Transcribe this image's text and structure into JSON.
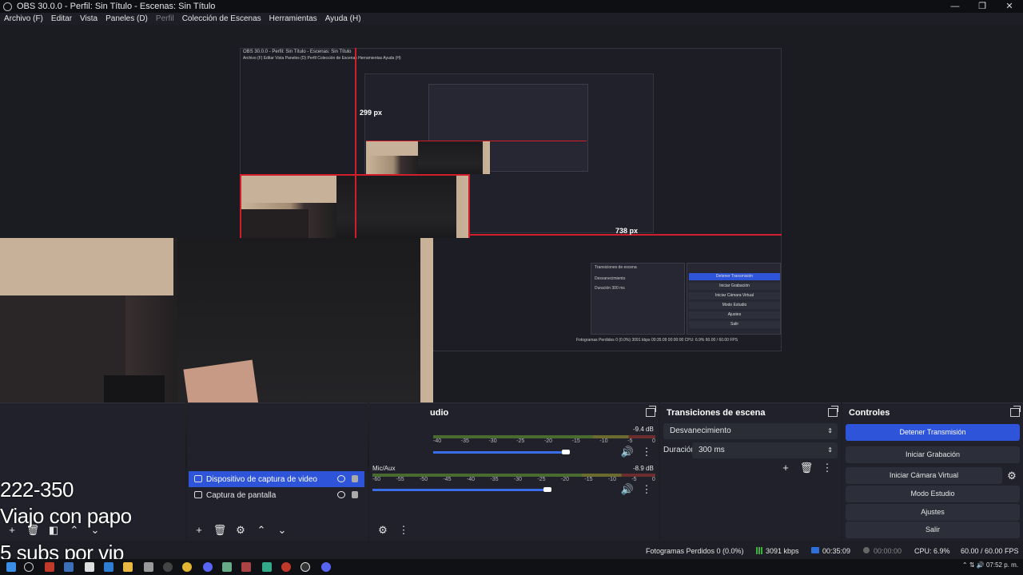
{
  "window": {
    "title": "OBS 30.0.0 - Perfil: Sin Título - Escenas: Sin Título",
    "controls": [
      "—",
      "❐",
      "✕"
    ]
  },
  "menu": [
    "Archivo (F)",
    "Editar",
    "Vista",
    "Paneles (D)",
    "Perfil",
    "Colección de Escenas",
    "Herramientas",
    "Ayuda (H)"
  ],
  "preview": {
    "nested_title": "OBS 30.0.0 - Perfil: Sin Título - Escenas: Sin Título",
    "nested_menu": "Archivo (F)   Editar   Vista   Paneles (D)   Perfil   Colección de Escenas   Herramientas   Ayuda (H)",
    "measure_top": "299 px",
    "measure_right": "738 px",
    "nested_controls": [
      "Detener Transmisión",
      "Iniciar Grabación",
      "Iniciar Cámara Virtual",
      "Modo Estudio",
      "Ajustes",
      "Salir"
    ],
    "nested_transition": "Desvanecimiento",
    "nested_duration_label": "Duración",
    "nested_duration": "300 ms",
    "nested_status": "Fotogramas Perdidos 0 (0.0%)   3091 kbps   00:35:09   00:00:00   CPU: 6.9%   60.00 / 60.00 FPS"
  },
  "overlay": {
    "line1": "222-350",
    "line2": "Viajo con papo",
    "line3": "5 subs por vip"
  },
  "sources": {
    "items": [
      {
        "label": "Dispositivo de captura de video",
        "selected": true
      },
      {
        "label": "Captura de pantalla",
        "selected": false
      }
    ]
  },
  "mixer": {
    "title": "udio",
    "tracks": [
      {
        "name": "",
        "db": "-9.4 dB",
        "level": 0.72
      },
      {
        "name": "Mic/Aux",
        "db": "-8.9 dB",
        "level": 0.74
      }
    ],
    "ticks": [
      "-60",
      "-55",
      "-50",
      "-45",
      "-40",
      "-35",
      "-30",
      "-25",
      "-20",
      "-15",
      "-10",
      "-5",
      "0"
    ]
  },
  "transitions": {
    "title": "Transiciones de escena",
    "selected": "Desvanecimiento",
    "duration_label": "Duración",
    "duration": "300 ms"
  },
  "controls": {
    "title": "Controles",
    "buttons": [
      "Detener Transmisión",
      "Iniciar Grabación",
      "Iniciar Cámara Virtual",
      "Modo Estudio",
      "Ajustes",
      "Salir"
    ]
  },
  "status": {
    "dropped": "Fotogramas Perdidos 0 (0.0%)",
    "bitrate": "3091 kbps",
    "stream_time": "00:35:09",
    "rec_time": "00:00:00",
    "cpu": "CPU: 6.9%",
    "fps": "60.00 / 60.00 FPS"
  },
  "taskbar": {
    "clock": "07:52 p. m.",
    "accent": "#2e55d9"
  }
}
